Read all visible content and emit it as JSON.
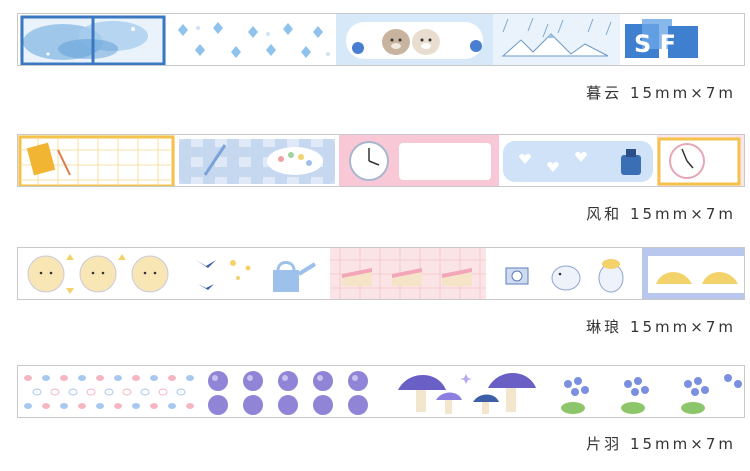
{
  "tapes": [
    {
      "name": "暮云",
      "size": "15mm×7m",
      "blue_letters": "S F"
    },
    {
      "name": "风和",
      "size": "15mm×7m"
    },
    {
      "name": "琳琅",
      "size": "15mm×7m"
    },
    {
      "name": "片羽",
      "size": "15mm×7m"
    }
  ],
  "colors": {
    "border": "#c9c9c9",
    "sky_blue": "#6fa8dc",
    "pale_blue": "#d7e9f8",
    "pink": "#f6cfd9",
    "yellow": "#f4d26b",
    "purple": "#7b6bc9",
    "green": "#8cc56a"
  },
  "icons": [
    "watercolor-window",
    "diamond-sparkles",
    "hamsters",
    "rainy-mountains",
    "notebook-grid",
    "gingham-palette",
    "clock",
    "ink-bottle",
    "teapot",
    "bird",
    "watering-can",
    "cake-slice",
    "camera-animal",
    "bread",
    "dots",
    "blueberries",
    "mushrooms",
    "hydrangea"
  ]
}
